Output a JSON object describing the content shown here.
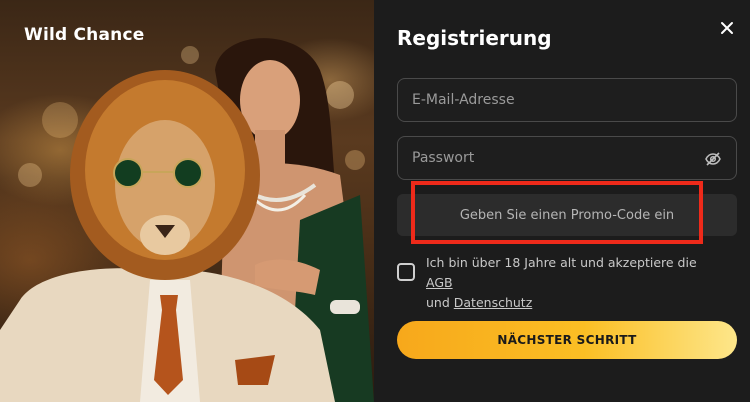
{
  "brand": {
    "name": "Wild Chance"
  },
  "registration": {
    "title": "Registrierung",
    "close_icon": "close-icon",
    "email_placeholder": "E-Mail-Adresse",
    "password_placeholder": "Passwort",
    "password_toggle_icon": "eye-off-icon",
    "promo_label": "Geben Sie einen Promo-Code ein",
    "terms": {
      "text_before": "Ich bin über 18 Jahre alt und akzeptiere die",
      "agb_link": "AGB",
      "and": "und",
      "privacy_link": "Datenschutz"
    },
    "next_button": "NÄCHSTER SCHRITT"
  },
  "colors": {
    "panel_bg": "#1c1c1c",
    "accent_start": "#f7a81b",
    "accent_end": "#fde68a",
    "highlight": "#ee2a1a"
  }
}
